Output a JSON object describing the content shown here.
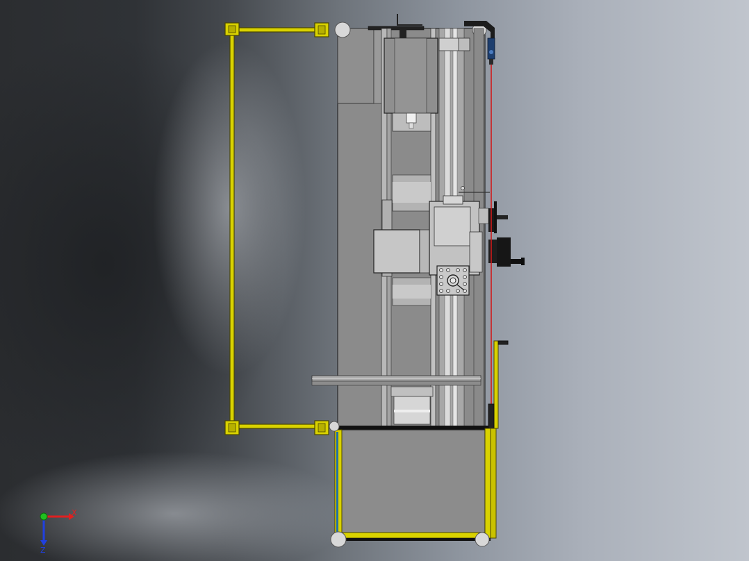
{
  "viewport": {
    "background_colors": [
      "#2b2d30",
      "#8f96a0",
      "#c0c5cd"
    ]
  },
  "model": {
    "frame_color": "#d9d200",
    "body_color": "#8c8c8c",
    "rail_color": "#b5b5b5",
    "wire_color": "#d11a1a"
  },
  "triad": {
    "x_label": "X",
    "z_label": "Z",
    "x_color": "#e02020",
    "z_color": "#2040e0",
    "y_color": "#20c020"
  }
}
